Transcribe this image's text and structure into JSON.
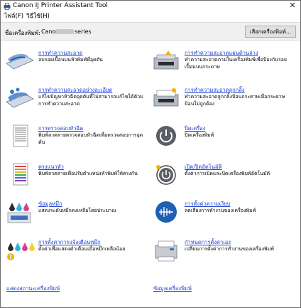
{
  "window": {
    "title": "Canon IJ Printer Assistant Tool",
    "close_glyph": "✕"
  },
  "menu": {
    "items": [
      "ไฟล์(F)",
      "วิธีใช้(H)"
    ]
  },
  "printer": {
    "label": "ชื่อเครื่องพิมพ์:",
    "name": "Canon",
    "series": "series",
    "select_button": "เลือกเครื่องพิมพ์..."
  },
  "left_items": [
    {
      "icon": "print-head-cleaning-icon",
      "link": "การทำความสะอาด",
      "desc": "ลบรอยเปื้อนบนหัวพิมพ์ที่อุดตัน"
    },
    {
      "icon": "deep-cleaning-icon",
      "link": "การทำความสะอาดอย่างละเอียด",
      "desc": "แก้ไขปัญหาหัวฉีดอุดตันที่ไม่สามารถแก้ไขได้ด้วยการทำความสะอาด"
    },
    {
      "icon": "nozzle-check-icon",
      "link": "การตรวจสอบหัวฉีด",
      "desc": "พิมพ์ลวดลายตรวจสอบหัวฉีดเพื่อตรวจสอบการอุดตัน"
    },
    {
      "icon": "print-head-alignment-icon",
      "link": "ตรงแนวหัว",
      "desc": "พิมพ์ลวดลายเพื่อปรับตำแหน่งหัวพิมพ์ให้ตรงกัน"
    },
    {
      "icon": "ink-level-icon",
      "link": "ข้อมูลหมึก",
      "desc": "แสดงระดับหมึกคงเหลือโดยประมาณ"
    },
    {
      "icon": "ink-warning-icon",
      "link": "การตั้งค่าการแจ้งเตือนหมึก",
      "desc": "ตั้งค่าเพื่อแสดงคำเตือนเมื่อหมึกเหลือน้อย"
    }
  ],
  "right_items": [
    {
      "icon": "bottom-plate-cleaning-icon",
      "link": "การทำความสะอาดแผ่นด้านล่าง",
      "desc": "ทำความสะอาดภายในเครื่องพิมพ์เพื่อป้องกันรอยเปื้อนบนกระดาษ"
    },
    {
      "icon": "roller-cleaning-icon",
      "link": "การทำความสะอาดลูกกลิ้ง",
      "desc": "ทำความสะอาดลูกกลิ้งป้อนกระดาษเมื่อกระดาษป้อนไม่ถูกต้อง"
    },
    {
      "icon": "power-off-icon",
      "link": "ปิดเครื่อง",
      "desc": "ปิดเครื่องพิมพ์"
    },
    {
      "icon": "auto-power-icon",
      "link": "เปิด/ปิดอัตโนมัติ",
      "desc": "ตั้งค่าการเปิดและปิดเครื่องพิมพ์อัตโนมัติ"
    },
    {
      "icon": "quiet-setting-icon",
      "link": "การตั้งค่าความเงียบ",
      "desc": "ลดเสียงการทำงานของเครื่องพิมพ์"
    },
    {
      "icon": "custom-settings-icon",
      "link": "กำหนดการตั้งค่าเอง",
      "desc": "เปลี่ยนการตั้งค่าการทำงานของเครื่องพิมพ์"
    }
  ],
  "footer": {
    "left_link": "แสดงสถานะเครื่องพิมพ์",
    "right_link": "ข้อมูลเครื่องพิมพ์"
  }
}
